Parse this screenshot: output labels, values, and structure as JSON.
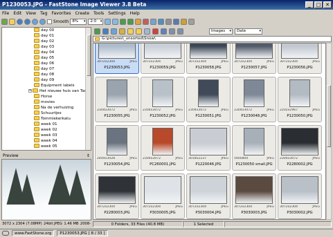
{
  "window": {
    "title": "P1230053.JPG  -  FastStone Image Viewer 3.8 Beta",
    "minimize": "_",
    "maximize": "□",
    "close": "✕"
  },
  "menu": [
    "File",
    "Edit",
    "View",
    "Tag",
    "Favorites",
    "Create",
    "Tools",
    "Settings",
    "Help"
  ],
  "toolbar": {
    "smooth_label": "Smooth",
    "zoom_value": "8%",
    "ratio_value": "2:0",
    "icons": [
      "folder-up-icon",
      "folder-icon",
      "back-icon",
      "forward-icon",
      "zoom-in-icon",
      "zoom-out-icon",
      "actual-size-icon",
      "fit-icon",
      "rotate-left-icon",
      "rotate-right-icon",
      "crop-icon",
      "resize-icon",
      "color-icon",
      "slideshow-icon",
      "fullscreen-icon",
      "print-icon",
      "email-icon",
      "settings-icon"
    ]
  },
  "right_toolbar": {
    "filter_value": "Images",
    "sort_value": "Date",
    "icons": [
      "copy-icon",
      "move-icon",
      "refresh-icon",
      "tag-icon",
      "select-all-icon",
      "folder-new-icon",
      "rename-icon",
      "delete-icon",
      "thumbnail-view-icon",
      "list-view-icon",
      "details-view-icon"
    ]
  },
  "tree": {
    "items": [
      {
        "label": "day 00",
        "expand": false
      },
      {
        "label": "day 01",
        "expand": false
      },
      {
        "label": "day 02",
        "expand": false
      },
      {
        "label": "day 03",
        "expand": false
      },
      {
        "label": "day 04",
        "expand": false
      },
      {
        "label": "day 05",
        "expand": false
      },
      {
        "label": "day 06",
        "expand": false
      },
      {
        "label": "day 07",
        "expand": false
      },
      {
        "label": "day 08",
        "expand": false
      },
      {
        "label": "day 09",
        "expand": false
      },
      {
        "label": "Equipment labels",
        "expand": false
      },
      {
        "label": "Het nieuwe huis van Tarja &",
        "expand": true
      },
      {
        "label": "Horse",
        "expand": false
      },
      {
        "label": "movies",
        "expand": false
      },
      {
        "label": "Na de verhuizing",
        "expand": false
      },
      {
        "label": "Schuurtjes",
        "expand": false
      },
      {
        "label": "Tommiekerkatu",
        "expand": false
      },
      {
        "label": "week 01",
        "expand": false
      },
      {
        "label": "week 02",
        "expand": false
      },
      {
        "label": "week 03",
        "expand": false
      },
      {
        "label": "week 04",
        "expand": false
      },
      {
        "label": "week 05",
        "expand": false
      }
    ]
  },
  "preview": {
    "header": "Preview",
    "toggle": "⇕",
    "dimensions": "3072 x 2304 (7.08MP)",
    "depth": "24bit JPEG",
    "size": "1.46 MB",
    "date": "2008-"
  },
  "path": "G:\\pictures\\_unsorted\\Snow\\",
  "thumbnails": [
    {
      "dims": "3072x2304",
      "type": "JPEG",
      "name": "P1230053.JPG",
      "selected": true,
      "color": "#aebccc",
      "orient": "land"
    },
    {
      "dims": "3072x2304",
      "type": "JPEG",
      "name": "P1230059.JPG",
      "selected": false,
      "color": "#c9cfd6",
      "orient": "land"
    },
    {
      "dims": "3072x2304",
      "type": "JPEG",
      "name": "P1230058.JPG",
      "selected": false,
      "color": "#3c4656",
      "orient": "land"
    },
    {
      "dims": "3072x2304",
      "type": "JPEG",
      "name": "P1230057.JPG",
      "selected": false,
      "color": "#515b6a",
      "orient": "land"
    },
    {
      "dims": "3072x2304",
      "type": "JPEG",
      "name": "P1230056.JPG",
      "selected": false,
      "color": "#c2c8cf",
      "orient": "land"
    },
    {
      "dims": "2304x3072",
      "type": "JPEG",
      "name": "P1230055.JPG",
      "selected": false,
      "color": "#9aa4ae",
      "orient": "port"
    },
    {
      "dims": "2304x3072",
      "type": "JPEG",
      "name": "P1230052.JPG",
      "selected": false,
      "color": "#b8c0c8",
      "orient": "port"
    },
    {
      "dims": "2304x3072",
      "type": "JPEG",
      "name": "P1230051.JPG",
      "selected": false,
      "color": "#404a58",
      "orient": "port"
    },
    {
      "dims": "2304x3072",
      "type": "JPEG",
      "name": "P1230048.JPG",
      "selected": false,
      "color": "#7e8896",
      "orient": "port"
    },
    {
      "dims": "2202x2967",
      "type": "JPEG",
      "name": "P1230050.JPG",
      "selected": false,
      "color": "#b2bac2",
      "orient": "port"
    },
    {
      "dims": "2444x3028",
      "type": "JPEG",
      "name": "P1230054.JPG",
      "selected": false,
      "color": "#6a7480",
      "orient": "port"
    },
    {
      "dims": "2304x3072",
      "type": "JPEG",
      "name": "PC260001.JPG",
      "selected": false,
      "color": "#b8492a",
      "orient": "port"
    },
    {
      "dims": "3018x2237",
      "type": "JPEG",
      "name": "P1220046.JPG",
      "selected": false,
      "color": "#c9ccd2",
      "orient": "land"
    },
    {
      "dims": "590x800",
      "type": "JPEG",
      "name": "P1230050 small.JPG",
      "selected": false,
      "color": "#a7b0b9",
      "orient": "port"
    },
    {
      "dims": "2304x3072",
      "type": "JPEG",
      "name": "P2280002.JPG",
      "selected": false,
      "color": "#2a2e33",
      "orient": "land"
    },
    {
      "dims": "3072x2304",
      "type": "JPEG",
      "name": "P2280003.JPG",
      "selected": false,
      "color": "#2f3338",
      "orient": "land"
    },
    {
      "dims": "3072x2304",
      "type": "JPEG",
      "name": "P3030005.JPG",
      "selected": false,
      "color": "#dfe3e7",
      "orient": "land"
    },
    {
      "dims": "3072x2304",
      "type": "JPEG",
      "name": "P3030004.JPG",
      "selected": false,
      "color": "#cdd3d9",
      "orient": "land"
    },
    {
      "dims": "3072x2304",
      "type": "JPEG",
      "name": "P3030003.JPG",
      "selected": false,
      "color": "#5a4a40",
      "orient": "land"
    },
    {
      "dims": "3072x2304",
      "type": "JPEG",
      "name": "P3030002.JPG",
      "selected": false,
      "color": "#b9c0c8",
      "orient": "land"
    }
  ],
  "status": {
    "folders": "0 Folders, 33 Files (40.8 MB)",
    "selected": "1 Selected"
  },
  "bottom": {
    "url": "www.FastStone.org",
    "file": "P1230053.JPG [ 8 / 33 ]"
  }
}
